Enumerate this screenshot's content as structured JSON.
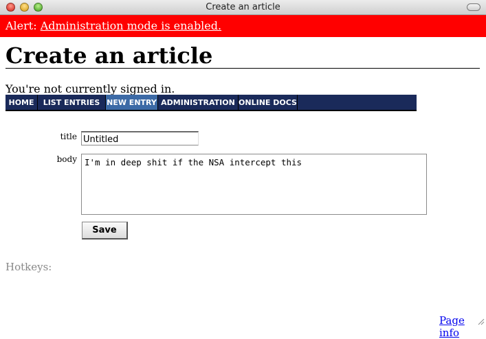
{
  "window": {
    "title": "Create an article"
  },
  "alert": {
    "prefix": "Alert: ",
    "link": "Administration mode is enabled."
  },
  "page": {
    "heading": "Create an article",
    "signin_status": "You're not currently signed in."
  },
  "nav": {
    "tabs": [
      "HOME",
      "LIST ENTRIES",
      "NEW ENTRY",
      "ADMINISTRATION",
      "ONLINE DOCS"
    ],
    "active": "NEW ENTRY"
  },
  "form": {
    "title_label": "title",
    "title_value": "Untitled",
    "body_label": "body",
    "body_value": "I'm in deep shit if the NSA intercept this",
    "save_label": "Save"
  },
  "footer": {
    "hotkeys": "Hotkeys:",
    "page_info": "Page info"
  },
  "colors": {
    "alert": "#ff0000",
    "nav": "#1a2a5a",
    "nav_active": "#3c6aa6"
  }
}
